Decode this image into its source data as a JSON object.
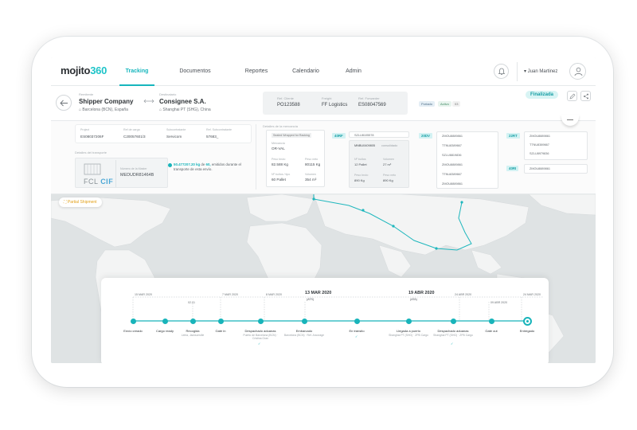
{
  "app": {
    "logo_main": "mojito",
    "logo_suffix": "360",
    "user": "▾ Juan Martinez"
  },
  "nav": {
    "tabs": [
      "Tracking",
      "Documentos",
      "Reportes",
      "Calendario",
      "Admin"
    ],
    "active": 0
  },
  "header": {
    "shipper": {
      "label": "Remitente",
      "name": "Shipper Company",
      "location": "⌂ Barcelona (BCN), España"
    },
    "consignee": {
      "label": "Destinatario",
      "name": "Consignee S.A.",
      "location": "⌂ Shanghai PT (SHG), China"
    },
    "refs": [
      {
        "label": "Ref. Cliente",
        "value": "PO123588"
      },
      {
        "label": "Freight",
        "value": "FF Logistics"
      },
      {
        "label": "Ref. Forwarder",
        "value": "ES08047569"
      }
    ],
    "chips": [
      "Portado",
      "Activo",
      "03"
    ],
    "status": "Finalizada"
  },
  "details": {
    "ids": [
      {
        "label": "Project",
        "value": "ES08037206F"
      },
      {
        "label": "Ref de carga",
        "value": "C20057601/3"
      },
      {
        "label": "Subcontratante",
        "value": "Servicom"
      },
      {
        "label": "Ref. Subcontratante",
        "value": "57683_"
      }
    ],
    "transport_label": "Detalles del transporte",
    "fcl": {
      "prefix": "FCL",
      "incoterm": "CIF"
    },
    "master": {
      "label": "Número de la Master",
      "value": "MEDUDR81464B"
    },
    "teu": {
      "highlight": "50.477207.20 kg",
      "mid": " de ",
      "highlight2": "60,",
      "rest": " emitidos durante el transporte de esta envío."
    },
    "cargo_label": "Detalles de la mercancía",
    "cargo": {
      "tag": "Sealed Wrapped for Racking",
      "commodity_label": "Mercancía",
      "commodity": "OR-VAL",
      "weight_label": "Peso bruto",
      "weight": "82.588 Kg",
      "net_label": "Peso neto",
      "net": "80115 Kg",
      "bultos_label": "Nº bultos / tipo",
      "bultos": "60 Pallet",
      "volume_label": "Volumen",
      "volume": "354 m³"
    },
    "containers": [
      {
        "type": "40RF",
        "id": "SZLU8105578",
        "second": "MNBU0409805",
        "second_note": "consolidado",
        "packs_label": "Nº bultos",
        "packs": "12 Pallet",
        "vol_label": "Volumen",
        "vol": "27 m³",
        "w_label": "Peso bruto",
        "w": "890 Kg",
        "n_label": "Peso neto",
        "n": "890 Kg"
      },
      {
        "type": "20DV",
        "list": [
          "ZMOU8889861",
          "TTNU8389667",
          "SZLU8819836",
          "ZMOU8889861",
          "TTNU8389667",
          "ZMOU8889861"
        ]
      },
      {
        "type": "22RT",
        "list": [
          "ZMOU8889861",
          "TTNU8389667",
          "SZLU8979836"
        ]
      },
      {
        "type": "40RI",
        "list": [
          "ZMOU8889861"
        ]
      }
    ]
  },
  "map": {
    "partial": "Partial Shipment"
  },
  "timeline": {
    "dates": [
      {
        "text": "15 MAR 2020"
      },
      {
        "text": "7 MAR 2020"
      },
      {
        "text": "8 MAR 2020"
      },
      {
        "text": "13 MAR 2020"
      },
      {
        "text": "19 ABR 2020"
      },
      {
        "text": "24 ABR 2020"
      },
      {
        "text": "24 MAR 2020"
      },
      {
        "text": "02.01"
      },
      {
        "text": "09 ABR 2020"
      }
    ],
    "ats": "(ATS)",
    "ata": "(ATA)",
    "stages": [
      {
        "label": "Envío creado",
        "sub": ""
      },
      {
        "label": "Cargo ready",
        "sub": ""
      },
      {
        "label": "Recogida",
        "sub": "Leiria, Jacksonville"
      },
      {
        "label": "Gate in",
        "sub": ""
      },
      {
        "label": "Despachado aduanas",
        "sub": "Puerto de Barcelona (BCN) · Cristina Gran"
      },
      {
        "label": "Embarcado",
        "sub": "Barcelona (BCN) · Ref. Ancorage"
      },
      {
        "label": "En tránsito",
        "sub": ""
      },
      {
        "label": "Llegada a puerto",
        "sub": "Shanghai PT (SHG) · ZPB Cargo"
      },
      {
        "label": "Despachado aduanas",
        "sub": "Shanghai PT (SHG) · ZPB Cargo"
      },
      {
        "label": "Gate out",
        "sub": ""
      },
      {
        "label": "Entregado",
        "sub": ""
      }
    ]
  }
}
